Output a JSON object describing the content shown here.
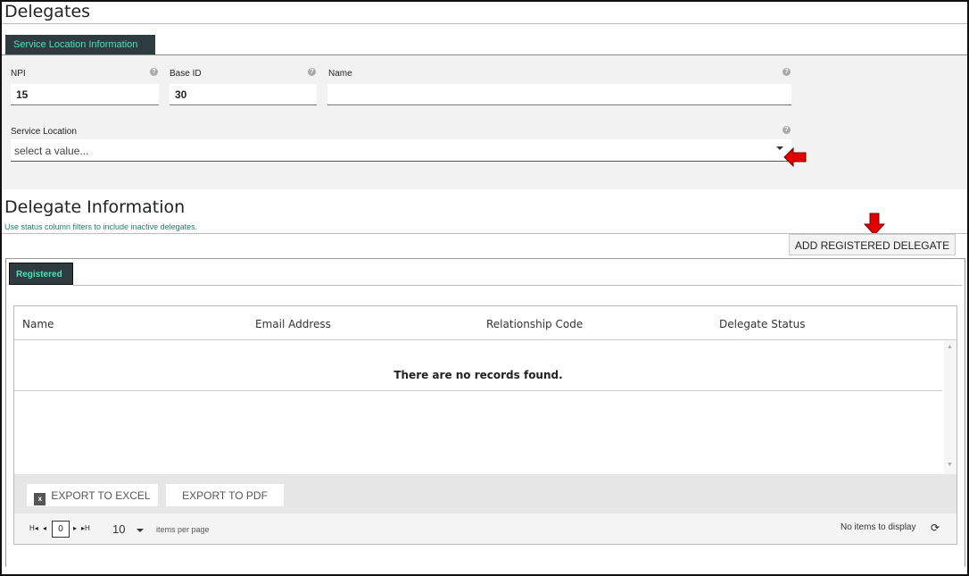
{
  "page": {
    "title": "Delegates"
  },
  "service_location_tab": {
    "label": "Service Location Information"
  },
  "form": {
    "npi": {
      "label": "NPI",
      "value": "15"
    },
    "base_id": {
      "label": "Base ID",
      "value": "30"
    },
    "name": {
      "label": "Name",
      "value": ""
    },
    "service_location": {
      "label": "Service Location",
      "placeholder": "select a value..."
    },
    "help_glyph": "?"
  },
  "delegate_section": {
    "title": "Delegate Information",
    "subtitle": "Use status column filters to include inactive delegates.",
    "add_button": "ADD REGISTERED DELEGATE",
    "tab": "Registered"
  },
  "grid": {
    "columns": [
      "Name",
      "Email Address",
      "Relationship Code",
      "Delegate Status"
    ],
    "empty_message": "There are no records found.",
    "export_excel": "EXPORT TO EXCEL",
    "export_pdf": "EXPORT TO PDF",
    "excel_icon_glyph": "x"
  },
  "pager": {
    "current_page": "0",
    "page_size": "10",
    "items_per_page_label": "items per page",
    "status": "No items to display",
    "first_glyph": "H◂",
    "prev_glyph": "◂",
    "next_glyph": "▸",
    "last_glyph": "▸H",
    "refresh_glyph": "⟳"
  },
  "annotations": {
    "arrow_color": "#e00000"
  }
}
